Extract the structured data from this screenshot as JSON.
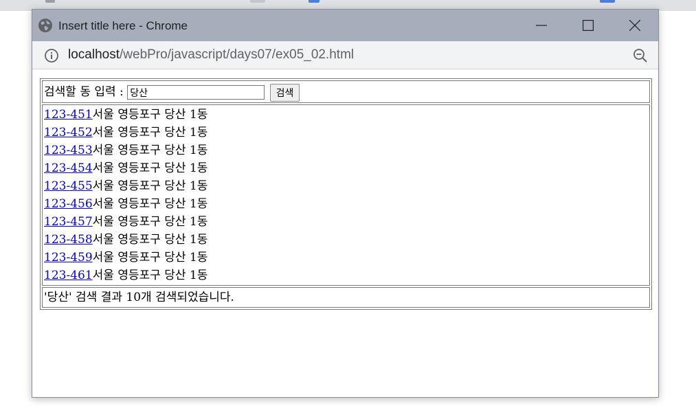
{
  "window": {
    "title": "Insert title here - Chrome",
    "icons": {
      "globe": "globe-icon",
      "minimize": "minimize-icon",
      "maximize": "maximize-icon",
      "close": "close-icon"
    }
  },
  "address": {
    "host": "localhost",
    "path": "/webPro/javascript/days07/ex05_02.html",
    "icons": {
      "info": "info-icon",
      "zoom": "zoom-out-icon"
    }
  },
  "search": {
    "label": "검색할 동 입력 :",
    "value": "당산",
    "button": "검색"
  },
  "results": [
    {
      "zip": "123-451",
      "address": "서울 영등포구 당산 1동"
    },
    {
      "zip": "123-452",
      "address": "서울 영등포구 당산 1동"
    },
    {
      "zip": "123-453",
      "address": "서울 영등포구 당산 1동"
    },
    {
      "zip": "123-454",
      "address": "서울 영등포구 당산 1동"
    },
    {
      "zip": "123-455",
      "address": "서울 영등포구 당산 1동"
    },
    {
      "zip": "123-456",
      "address": "서울 영등포구 당산 1동"
    },
    {
      "zip": "123-457",
      "address": "서울 영등포구 당산 1동"
    },
    {
      "zip": "123-458",
      "address": "서울 영등포구 당산 1동"
    },
    {
      "zip": "123-459",
      "address": "서울 영등포구 당산 1동"
    },
    {
      "zip": "123-461",
      "address": "서울 영등포구 당산 1동"
    }
  ],
  "status": "'당산' 검색 결과 10개 검색되었습니다.",
  "colors": {
    "titlebar": "#a7adba",
    "link": "#0000ee"
  }
}
